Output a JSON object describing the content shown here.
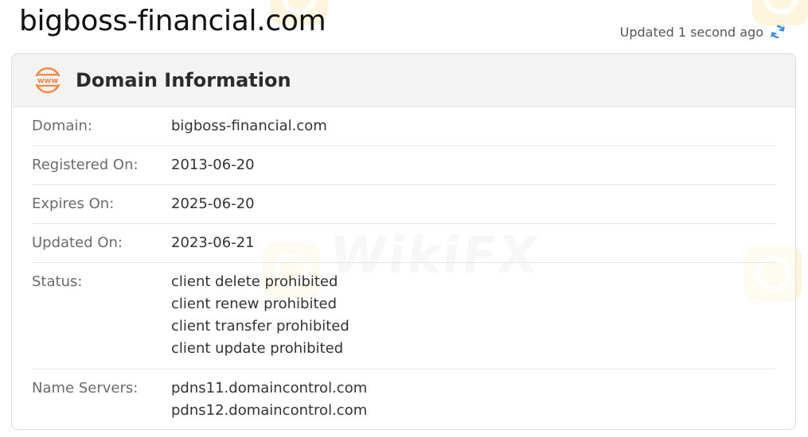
{
  "site": {
    "title": "bigboss-financial.com",
    "updated_text": "Updated 1 second ago",
    "refresh_icon": "refresh-icon"
  },
  "card": {
    "title": "Domain Information",
    "icon": "www-icon",
    "rows": [
      {
        "label": "Domain:",
        "value": "bigboss-financial.com"
      },
      {
        "label": "Registered On:",
        "value": "2013-06-20"
      },
      {
        "label": "Expires On:",
        "value": "2025-06-20"
      },
      {
        "label": "Updated On:",
        "value": "2023-06-21"
      }
    ],
    "status": {
      "label": "Status:",
      "values": [
        "client delete prohibited",
        "client renew prohibited",
        "client transfer prohibited",
        "client update prohibited"
      ]
    },
    "name_servers": {
      "label": "Name Servers:",
      "values": [
        "pdns11.domaincontrol.com",
        "pdns12.domaincontrol.com"
      ]
    }
  },
  "watermark": {
    "text": "WikiFX"
  },
  "colors": {
    "accent_orange": "#f08a45",
    "refresh_blue": "#3a8ee6",
    "watermark_yellow": "#f7c94a"
  }
}
